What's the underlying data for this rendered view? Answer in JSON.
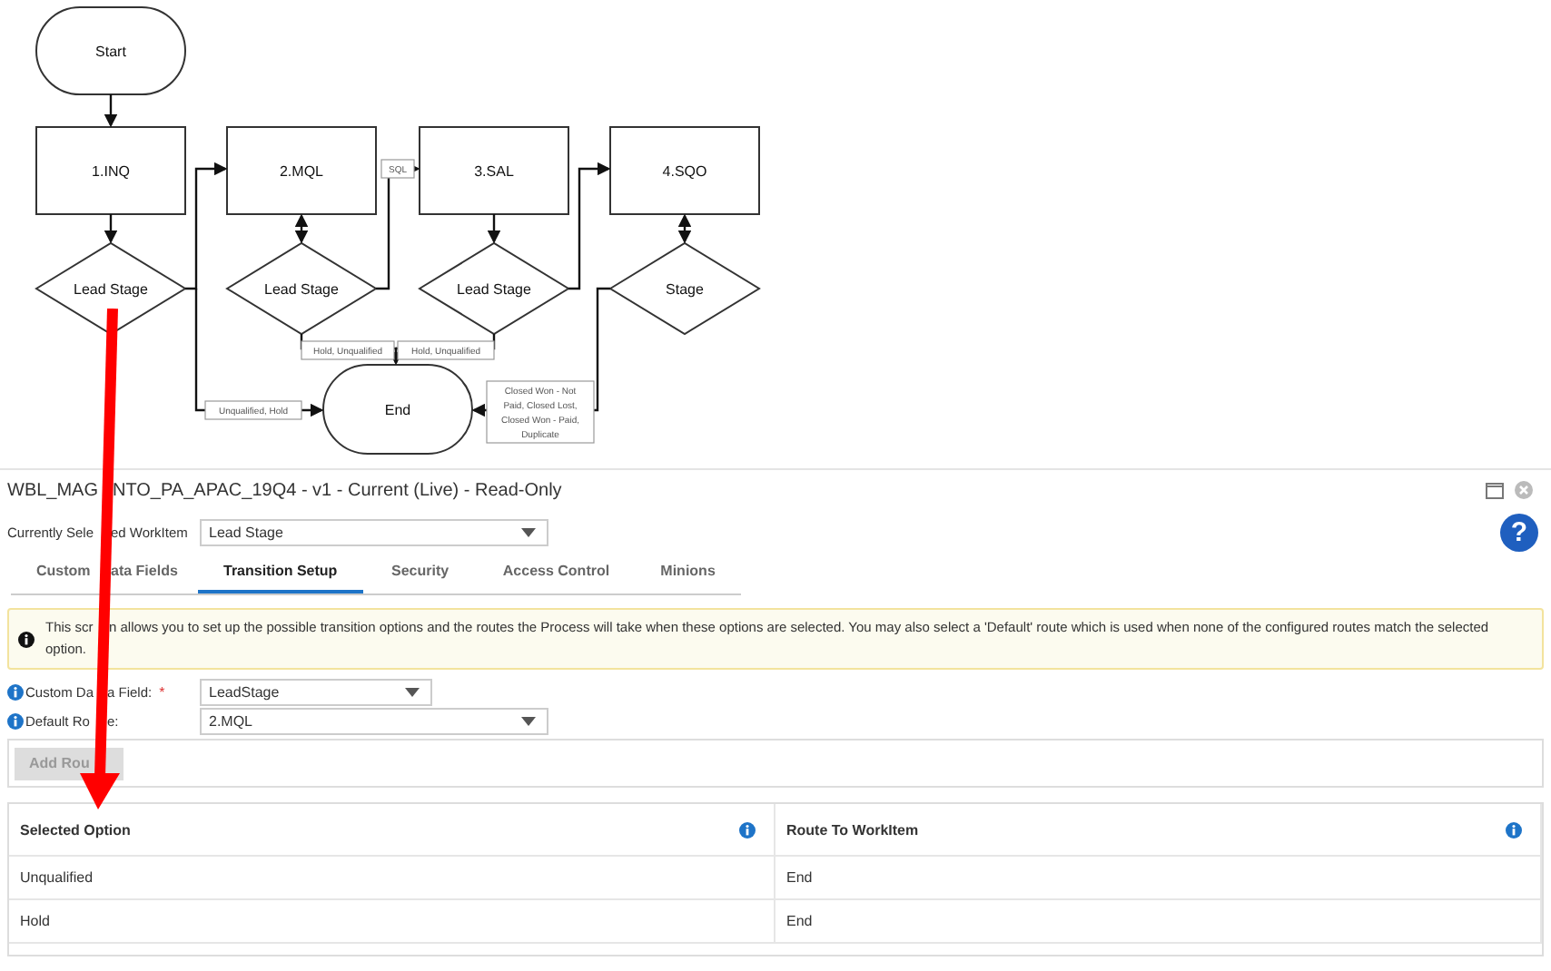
{
  "diagram": {
    "nodes": [
      {
        "kind": "terminal",
        "label": "Start"
      },
      {
        "kind": "process",
        "label": "1.INQ"
      },
      {
        "kind": "process",
        "label": "2.MQL"
      },
      {
        "kind": "process",
        "label": "3.SAL"
      },
      {
        "kind": "process",
        "label": "4.SQO"
      },
      {
        "kind": "decision",
        "label": "Lead Stage"
      },
      {
        "kind": "decision",
        "label": "Lead Stage"
      },
      {
        "kind": "decision",
        "label": "Lead Stage"
      },
      {
        "kind": "decision",
        "label": "Stage"
      },
      {
        "kind": "terminal",
        "label": "End"
      }
    ],
    "edge_labels": [
      {
        "lines": [
          "SQL"
        ]
      },
      {
        "lines": [
          "Hold, Unqualified"
        ]
      },
      {
        "lines": [
          "Hold, Unqualified"
        ]
      },
      {
        "lines": [
          "Unqualified, Hold"
        ]
      },
      {
        "lines": [
          "Closed Won - Not",
          "Paid, Closed Lost,",
          "Closed Won - Paid,",
          "Duplicate"
        ]
      }
    ]
  },
  "window": {
    "title": [
      "WBL_MAG",
      "NTO_PA_APAC_19Q4 - v1 - Current (Live) - Read-Only"
    ]
  },
  "help": "?",
  "workitem": {
    "label": [
      "Currently Sele",
      "ed WorkItem"
    ],
    "value": "Lead Stage"
  },
  "tabs": [
    {
      "label": [
        "Custom",
        "ata Fields"
      ],
      "selected": false
    },
    {
      "label": [
        "Transition Setup"
      ],
      "selected": true
    },
    {
      "label": [
        "Security"
      ],
      "selected": false
    },
    {
      "label": [
        "Access Control"
      ],
      "selected": false
    },
    {
      "label": [
        "Minions"
      ],
      "selected": false
    }
  ],
  "banner": [
    "This scr",
    "n allows you to set up the possible transition options and the routes the Process will take when these options are selected. You may also select a 'Default' route which is used when none of the configured routes match the selected",
    "option."
  ],
  "fields": [
    {
      "label": [
        "Custom Da",
        "a Field:"
      ],
      "required": true,
      "value": "LeadStage",
      "wide": false
    },
    {
      "label": [
        "Default Ro",
        "e:"
      ],
      "required": false,
      "value": "2.MQL",
      "wide": true
    }
  ],
  "required_mark": "*",
  "add_button": {
    "label": "Add Rou",
    "disabled": true
  },
  "table": {
    "columns": [
      "Selected Option",
      "Route To WorkItem"
    ],
    "rows": [
      [
        "Unqualified",
        "End"
      ],
      [
        "Hold",
        "End"
      ]
    ]
  }
}
